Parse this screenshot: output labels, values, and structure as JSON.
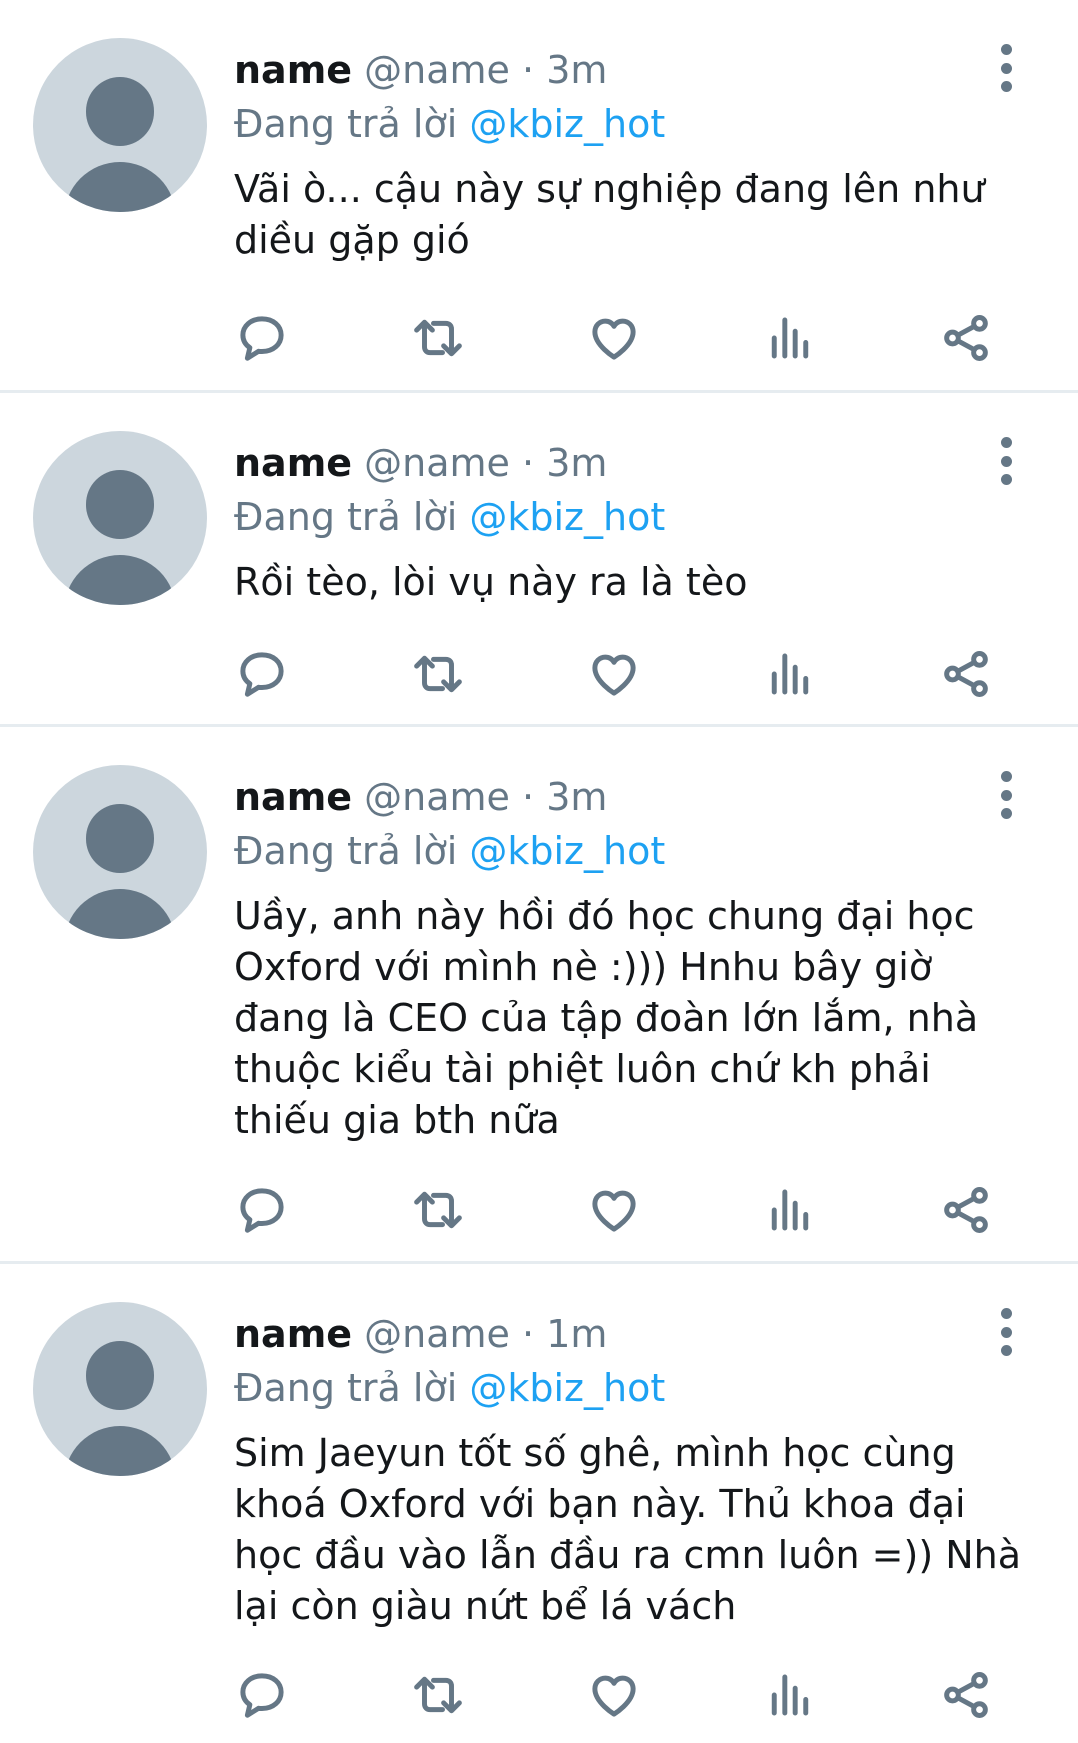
{
  "tweets": [
    {
      "name": "name",
      "handle": "@name",
      "time": "3m",
      "reply_prefix": "Đang trả lời",
      "reply_to": "@kbiz_hot",
      "text": "Vãi ò... cậu này sự nghiệp đang lên như diều gặp gió"
    },
    {
      "name": "name",
      "handle": "@name",
      "time": "3m",
      "reply_prefix": "Đang trả lời",
      "reply_to": "@kbiz_hot",
      "text": "Rồi tèo, lòi vụ này ra là tèo"
    },
    {
      "name": "name",
      "handle": "@name",
      "time": "3m",
      "reply_prefix": "Đang trả lời",
      "reply_to": "@kbiz_hot",
      "text": "Uầy, anh này hồi đó học chung đại học Oxford với mình nè :))) Hnhu bây giờ đang là CEO của tập đoàn lớn lắm, nhà thuộc kiểu tài phiệt luôn chứ kh phải thiếu gia bth nữa"
    },
    {
      "name": "name",
      "handle": "@name",
      "time": "1m",
      "reply_prefix": "Đang trả lời",
      "reply_to": "@kbiz_hot",
      "text": "Sim Jaeyun tốt số ghê, mình học cùng khoá Oxford với bạn này. Thủ khoa đại học đầu vào lẫn đầu ra cmn luôn =)) Nhà lại còn giàu nứt bể lá vách"
    }
  ],
  "icons": {
    "avatar": "default-avatar-icon",
    "more": "more-vertical-icon",
    "reply": "reply-bubble-icon",
    "retweet": "retweet-icon",
    "like": "heart-icon",
    "analytics": "analytics-bars-icon",
    "share": "share-icon"
  },
  "colors": {
    "mention": "#1da1f2",
    "secondary_text": "#657786",
    "avatar_bg": "#ccd6dd",
    "divider": "#e6ecf0"
  }
}
